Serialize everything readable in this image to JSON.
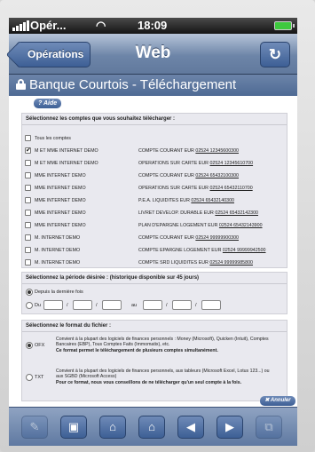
{
  "status": {
    "carrier": "Opér...",
    "time": "18:09"
  },
  "nav": {
    "back_label": "Opérations",
    "title": "Web",
    "refresh_icon": "refresh-icon"
  },
  "banner": {
    "title": "Banque Courtois - Téléchargement"
  },
  "help_label": "Aide",
  "accounts_section": {
    "heading": "Sélectionnez les comptes que vous souhaitez télécharger :",
    "all_label": "Tous les comptes",
    "rows": [
      {
        "owner": "M ET MME INTERNET DEMO",
        "account": "COMPTE COURANT EUR",
        "number": "02524 12345600300",
        "checked": true
      },
      {
        "owner": "M ET MME INTERNET DEMO",
        "account": "OPERATIONS SUR CARTE EUR",
        "number": "02524 12345610700",
        "checked": false
      },
      {
        "owner": "MME INTERNET DEMO",
        "account": "COMPTE COURANT EUR",
        "number": "02524 65432100300",
        "checked": false
      },
      {
        "owner": "MME INTERNET DEMO",
        "account": "OPERATIONS SUR CARTE EUR",
        "number": "02524 65432110700",
        "checked": false
      },
      {
        "owner": "MME INTERNET DEMO",
        "account": "P.E.A. LIQUIDITES EUR",
        "number": "02524 65432140300",
        "checked": false
      },
      {
        "owner": "MME INTERNET DEMO",
        "account": "LIVRET DEVELOP. DURABLE EUR",
        "number": "02524 65432142300",
        "checked": false
      },
      {
        "owner": "MME INTERNET DEMO",
        "account": "PLAN D'EPARGNE LOGEMENT EUR",
        "number": "02524 65432143900",
        "checked": false
      },
      {
        "owner": "M. INTERNET DEMO",
        "account": "COMPTE COURANT EUR",
        "number": "02524 99999900300",
        "checked": false
      },
      {
        "owner": "M. INTERNET DEMO",
        "account": "COMPTE EPARGNE LOGEMENT EUR",
        "number": "02524 99999942500",
        "checked": false
      },
      {
        "owner": "M. INTERNET DEMO",
        "account": "COMPTE SRD LIQUIDITES EUR",
        "number": "02524 99999985800",
        "checked": false
      }
    ]
  },
  "period_section": {
    "heading": "Sélectionnez la période désirée : (historique disponible sur 45 jours)",
    "last_time_label": "Depuis la dernière fois",
    "from_label": "Du",
    "to_label": "au",
    "separator": "/"
  },
  "format_section": {
    "heading": "Sélectionnez le format du fichier :",
    "ofx": {
      "label": "OFX",
      "desc": "Convient à la plupart des logiciels de finances personnels : Money (Microsoft), Quicken (Intuit), Comptes Bancaires (EBP), Tous Comptes Faits (Immomatix), etc.",
      "note": "Ce format permet le téléchargement de plusieurs comptes simultanément."
    },
    "txt": {
      "label": "TXT",
      "desc": "Convient à la plupart des logiciels de finances personnels, aux tableurs (Microsoft Excel, Lotus 123...) ou aux SGBD (Microsoft Access)",
      "note": "Pour ce format, nous vous conseillons de ne télécharger qu'un seul compte à la fois."
    }
  },
  "cancel_label": "Annuler",
  "toolbar_icons": [
    "pencil-icon",
    "save-icon",
    "add-home-icon",
    "home-icon",
    "back-icon",
    "forward-icon",
    "tabs-icon"
  ]
}
